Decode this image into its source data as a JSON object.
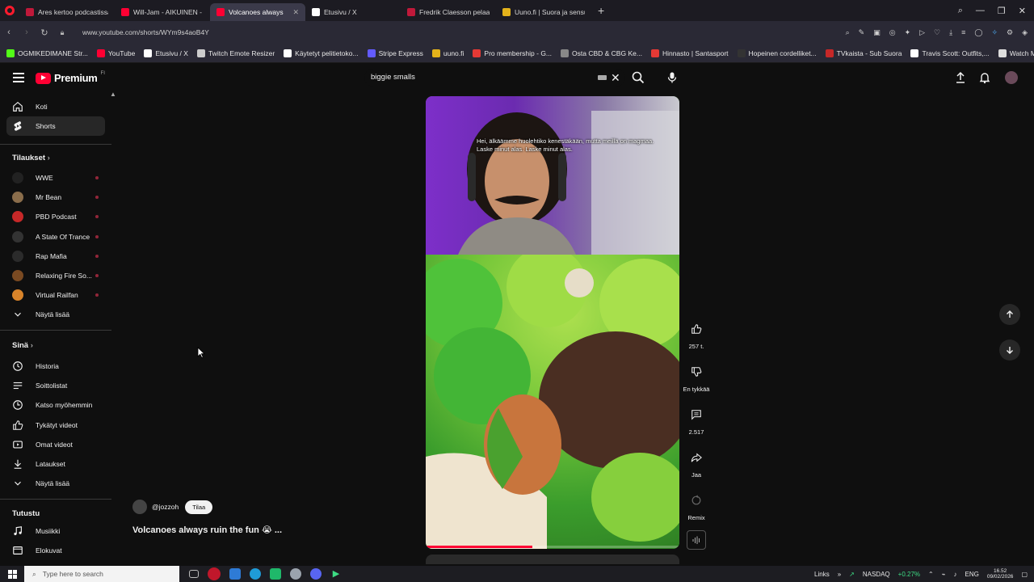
{
  "browser": {
    "tabs": [
      {
        "label": "Ares kertoo podcastissa v",
        "color": "#c0193a",
        "active": false
      },
      {
        "label": "Will-Jam - AIKUINEN - Yo",
        "color": "#ff0033",
        "active": false
      },
      {
        "label": "Volcanoes always ruin",
        "color": "#ff0033",
        "active": true
      },
      {
        "label": "Etusivu / X",
        "color": "#ffffff",
        "active": false
      },
      {
        "label": "Fredrik Claesson pelaa Ve",
        "color": "#c0193a",
        "active": false
      },
      {
        "label": "Uuno.fi | Suora ja sensuro",
        "color": "#e3b21b",
        "active": false
      }
    ],
    "url": "www.youtube.com/shorts/WYm9s4aoB4Y",
    "bookmarks": [
      {
        "label": "OGMIKEDIMANE Str...",
        "color": "#53fc18"
      },
      {
        "label": "YouTube",
        "color": "#ff0033"
      },
      {
        "label": "Etusivu / X",
        "color": "#ffffff"
      },
      {
        "label": "Twitch Emote Resizer",
        "color": "#cccccc"
      },
      {
        "label": "Käytetyt pelitietoko...",
        "color": "#ffffff"
      },
      {
        "label": "Stripe Express",
        "color": "#635bff"
      },
      {
        "label": "uuno.fi",
        "color": "#e3b21b"
      },
      {
        "label": "Pro membership - G...",
        "color": "#e53935"
      },
      {
        "label": "Osta CBD & CBG Ke...",
        "color": "#888888"
      },
      {
        "label": "Hinnasto | Santasport",
        "color": "#e53935"
      },
      {
        "label": "Hopeinen cordelliket...",
        "color": "#333333"
      },
      {
        "label": "TVkaista - Sub Suora",
        "color": "#c62828"
      },
      {
        "label": "Travis Scott: Outfits,...",
        "color": "#ffffff"
      },
      {
        "label": "Watch Marvel's Luk...",
        "color": "#dddddd"
      }
    ]
  },
  "header": {
    "logo_text": "Premium",
    "logo_region": "FI",
    "search_value": "biggie smalls"
  },
  "sidebar": {
    "main": [
      {
        "label": "Koti",
        "icon": "home-icon"
      },
      {
        "label": "Shorts",
        "icon": "shorts-icon",
        "active": true
      }
    ],
    "subscriptions_heading": "Tilaukset",
    "subscriptions": [
      {
        "label": "WWE",
        "color": "#222222"
      },
      {
        "label": "Mr Bean",
        "color": "#8a6d4b"
      },
      {
        "label": "PBD Podcast",
        "color": "#c62828"
      },
      {
        "label": "A State Of Trance",
        "color": "#333333"
      },
      {
        "label": "Rap Mafia",
        "color": "#2b2b2b"
      },
      {
        "label": "Relaxing Fire So...",
        "color": "#7a4a22"
      },
      {
        "label": "Virtual Railfan",
        "color": "#d9842a"
      }
    ],
    "subs_more": "Näytä lisää",
    "you_heading": "Sinä",
    "you": [
      {
        "label": "Historia",
        "icon": "history-icon"
      },
      {
        "label": "Soittolistat",
        "icon": "playlists-icon"
      },
      {
        "label": "Katso myöhemmin",
        "icon": "watch-later-icon"
      },
      {
        "label": "Tykätyt videot",
        "icon": "liked-videos-icon"
      },
      {
        "label": "Omat videot",
        "icon": "my-videos-icon"
      },
      {
        "label": "Lataukset",
        "icon": "downloads-icon"
      }
    ],
    "you_more": "Näytä lisää",
    "explore_heading": "Tutustu",
    "explore": [
      {
        "label": "Musiikki",
        "icon": "music-icon"
      },
      {
        "label": "Elokuvat",
        "icon": "movies-icon"
      }
    ]
  },
  "video": {
    "caption": "Hei, älkäämme huolehtiko kenestäkään, mutta meillä on magmaa.  Laske minut alas.  Laske minut alas.",
    "progress": 0.42,
    "channel": "@jozzoh",
    "subscribe_label": "Tilaa",
    "title": "Volcanoes always ruin the fun 😭 ..."
  },
  "actions": {
    "likes": "257 t.",
    "dislike_label": "En tykkää",
    "comments": "2.517",
    "share_label": "Jaa",
    "remix_label": "Remix"
  },
  "taskbar": {
    "search_placeholder": "Type here to search",
    "links_label": "Links",
    "ticker": "NASDAQ",
    "ticker_change": "+0.27%",
    "lang": "ENG",
    "time": "16.52",
    "date": "09/02/2026"
  }
}
